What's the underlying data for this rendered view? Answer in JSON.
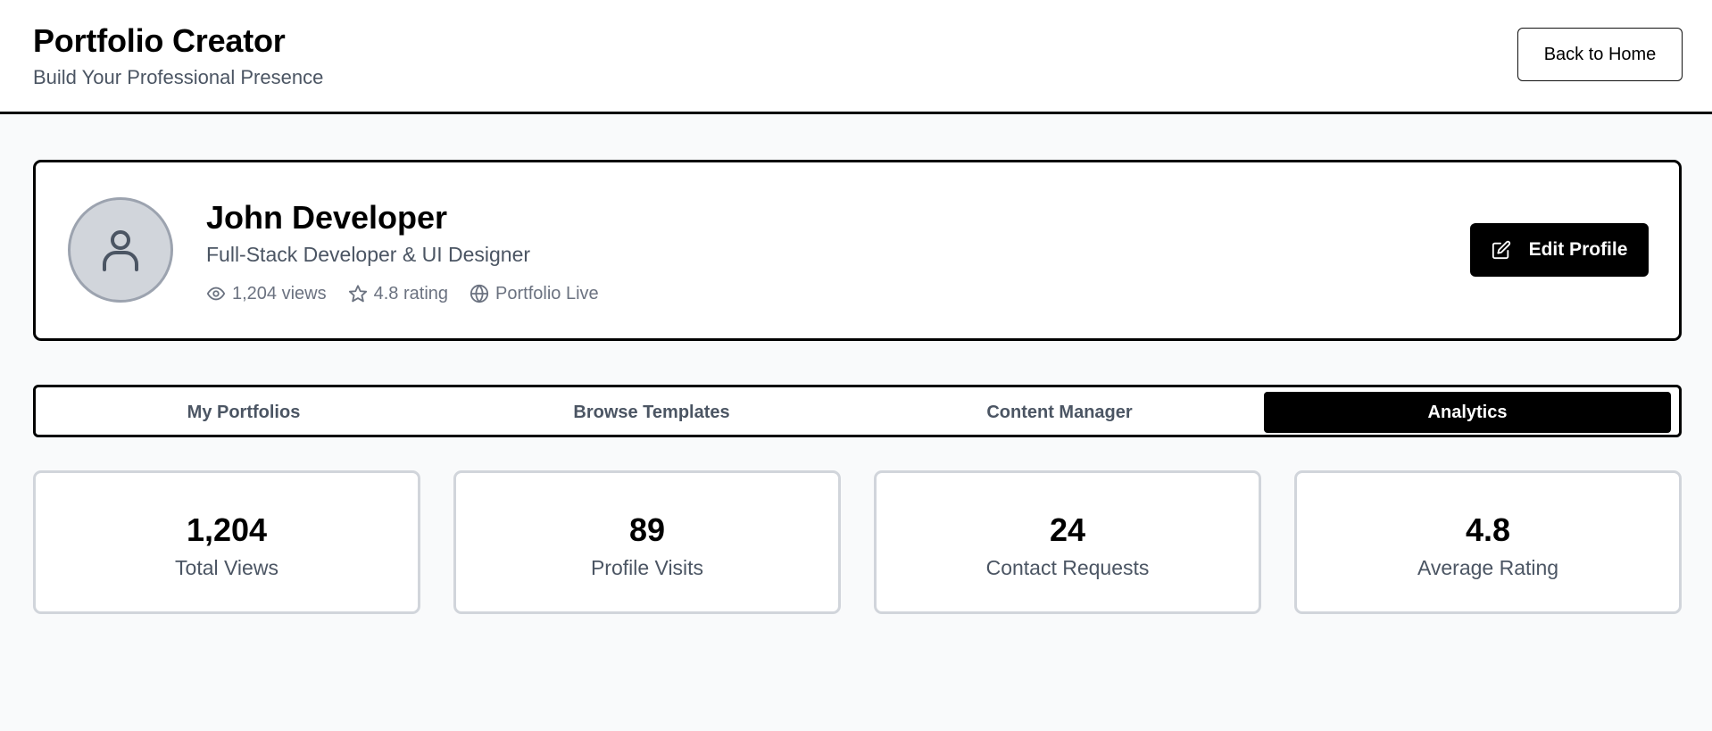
{
  "header": {
    "title": "Portfolio Creator",
    "subtitle": "Build Your Professional Presence",
    "back_label": "Back to Home"
  },
  "profile": {
    "name": "John Developer",
    "role": "Full-Stack Developer & UI Designer",
    "views": "1,204 views",
    "rating": "4.8 rating",
    "status": "Portfolio Live",
    "edit_label": "Edit Profile"
  },
  "tabs": [
    {
      "label": "My Portfolios",
      "active": false
    },
    {
      "label": "Browse Templates",
      "active": false
    },
    {
      "label": "Content Manager",
      "active": false
    },
    {
      "label": "Analytics",
      "active": true
    }
  ],
  "stats": [
    {
      "value": "1,204",
      "label": "Total Views"
    },
    {
      "value": "89",
      "label": "Profile Visits"
    },
    {
      "value": "24",
      "label": "Contact Requests"
    },
    {
      "value": "4.8",
      "label": "Average Rating"
    }
  ],
  "icons": {
    "avatar": "user-icon",
    "views": "eye-icon",
    "rating": "star-icon",
    "status": "globe-icon",
    "edit": "edit-icon"
  }
}
